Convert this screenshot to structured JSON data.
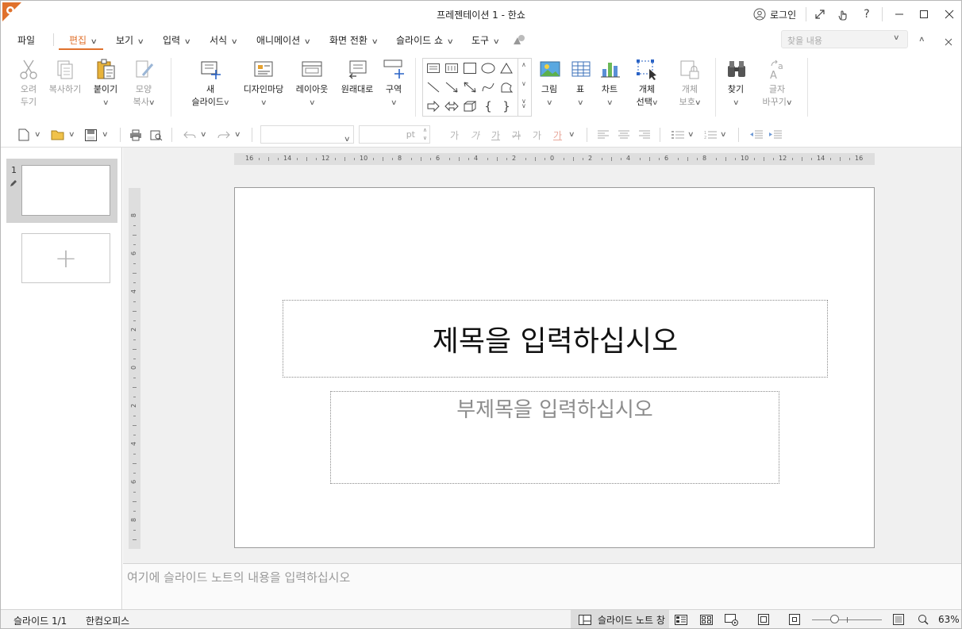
{
  "window": {
    "title": "프레젠테이션 1 - 한쇼",
    "login": "로그인"
  },
  "menu": {
    "items": [
      {
        "label": "파일"
      },
      {
        "label": "편집",
        "active": true
      },
      {
        "label": "보기"
      },
      {
        "label": "입력"
      },
      {
        "label": "서식"
      },
      {
        "label": "애니메이션"
      },
      {
        "label": "화면 전환"
      },
      {
        "label": "슬라이드 쇼"
      },
      {
        "label": "도구"
      }
    ],
    "search_placeholder": "찾을 내용"
  },
  "ribbon": {
    "cut": {
      "line1": "오려",
      "line2": "두기"
    },
    "copy": {
      "line1": "복사하기"
    },
    "paste": {
      "line1": "붙이기"
    },
    "format_painter": {
      "line1": "모양",
      "line2": "복사"
    },
    "new_slide": {
      "line1": "새",
      "line2": "슬라이드"
    },
    "design": {
      "line1": "디자인마당"
    },
    "layout": {
      "line1": "레이아웃"
    },
    "reset": {
      "line1": "원래대로"
    },
    "section": {
      "line1": "구역"
    },
    "picture": {
      "line1": "그림"
    },
    "table": {
      "line1": "표"
    },
    "chart": {
      "line1": "차트"
    },
    "select_object": {
      "line1": "개체",
      "line2": "선택"
    },
    "protect_object": {
      "line1": "개체",
      "line2": "보호"
    },
    "find": {
      "line1": "찾기"
    },
    "replace": {
      "line1": "글자",
      "line2": "바꾸기"
    }
  },
  "toolbar": {
    "font_size_unit": "pt",
    "char_buttons": [
      "가",
      "가",
      "가",
      "가",
      "가",
      "가"
    ]
  },
  "thumbnails": {
    "slide_number": "1"
  },
  "slide": {
    "title_placeholder": "제목을 입력하십시오",
    "subtitle_placeholder": "부제목을 입력하십시오"
  },
  "ruler": {
    "h_labels": [
      "16",
      "14",
      "12",
      "10",
      "8",
      "6",
      "4",
      "2",
      "0",
      "2",
      "4",
      "6",
      "8",
      "10",
      "12",
      "14",
      "16"
    ],
    "v_labels": [
      "8",
      "6",
      "4",
      "2",
      "0",
      "2",
      "4",
      "6",
      "8"
    ]
  },
  "notes_placeholder": "여기에 슬라이드 노트의 내용을 입력하십시오",
  "status": {
    "slide_counter": "슬라이드 1/1",
    "app_name": "한컴오피스",
    "notes_toggle": "슬라이드 노트 창",
    "zoom": "63%"
  },
  "colors": {
    "accent": "#e0712c",
    "canvas": "#f0f0f0",
    "ruler": "#dedede",
    "selection": "#d3d3d3"
  }
}
